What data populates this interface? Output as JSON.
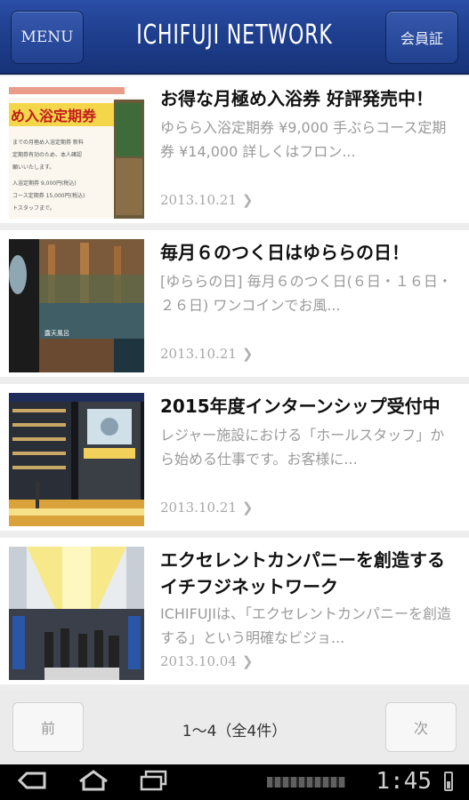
{
  "header": {
    "menu_label": "MENU",
    "logo_text": "ICHIFUJI NETWORK",
    "member_label": "会員証"
  },
  "items": [
    {
      "title": "お得な月極め入浴券 好評発売中！",
      "desc": "ゆらら入浴定期券 ¥9,000 手ぶらコース定期券 ¥14,000 詳しくはフロン...",
      "date": "2013.10.21",
      "thumb": "bath-ticket-flyer"
    },
    {
      "title": "毎月６のつく日はゆららの日！",
      "desc": "[ゆららの日] 毎月６のつく日(６日・１６日・２６日) ワンコインでお風...",
      "date": "2013.10.21",
      "thumb": "outdoor-bath"
    },
    {
      "title": "2015年度インターンシップ受付中",
      "desc": "レジャー施設における「ホールスタッフ」から始める仕事です。お客様に...",
      "date": "2013.10.21",
      "thumb": "building-night"
    },
    {
      "title": "エクセレントカンパニーを創造するイチフジネットワーク",
      "desc": "ICHIFUJIは、「エクセレントカンパニーを創造する」という明確なビジョ...",
      "date": "2013.10.04",
      "thumb": "hall-interior"
    }
  ],
  "pager": {
    "prev_label": "前",
    "count_text": "1〜4（全4件）",
    "next_label": "次"
  },
  "status_bar": {
    "clock": "1:45"
  }
}
